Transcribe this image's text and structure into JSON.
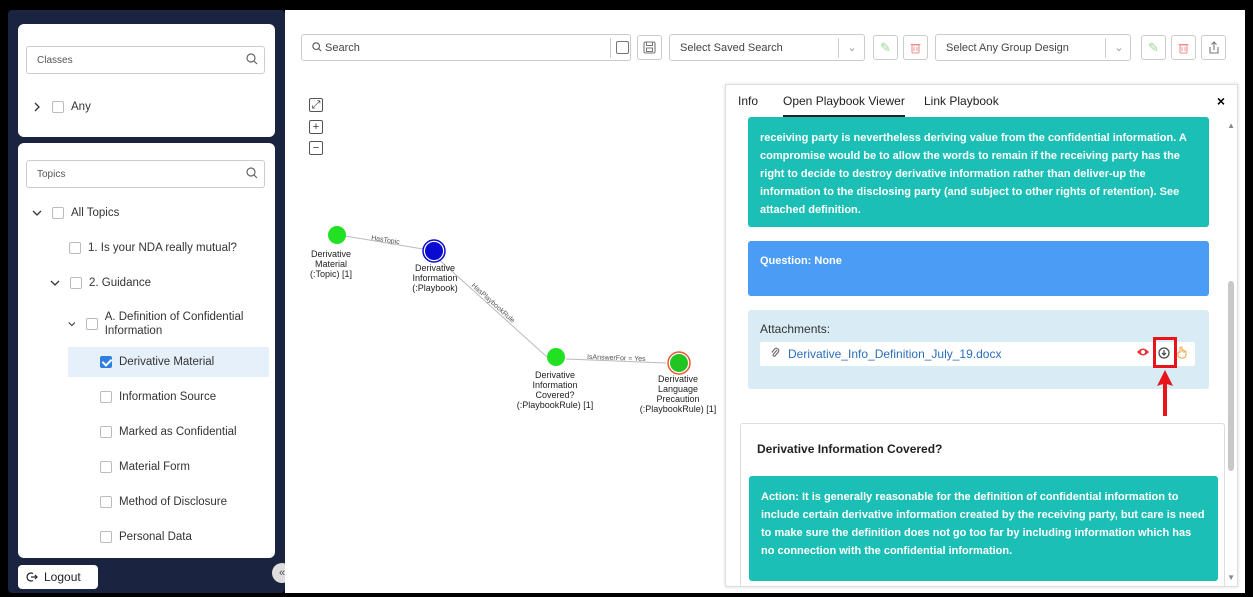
{
  "sidebar": {
    "classes_placeholder": "Classes",
    "classes_tree": [
      {
        "label": "Any"
      }
    ],
    "topics_placeholder": "Topics",
    "topics_tree": [
      {
        "label": "All Topics"
      },
      {
        "label": "1. Is your NDA really mutual?"
      },
      {
        "label": "2. Guidance"
      },
      {
        "label": "A. Definition of Confidential Information"
      },
      {
        "label": "Derivative Material",
        "checked": true
      },
      {
        "label": "Information Source"
      },
      {
        "label": "Marked as Confidential"
      },
      {
        "label": "Material Form"
      },
      {
        "label": "Method of Disclosure"
      },
      {
        "label": "Personal Data"
      }
    ],
    "logout_label": "Logout",
    "collapse_icon": "«"
  },
  "toolbar": {
    "search_placeholder": "Search",
    "saved_search_placeholder": "Select Saved Search",
    "group_design_placeholder": "Select Any Group Design"
  },
  "graph": {
    "nodes": [
      {
        "id": "n1",
        "label": "Derivative Material (:Topic) [1]",
        "color": "#22e022"
      },
      {
        "id": "n2",
        "label": "Derivative Information (:Playbook)",
        "color": "#0a0ad0"
      },
      {
        "id": "n3",
        "label": "Derivative Information Covered? (:PlaybookRule) [1]",
        "color": "#22e022"
      },
      {
        "id": "n4",
        "label": "Derivative Language Precaution (:PlaybookRule) [1]",
        "color": "#22c422"
      }
    ],
    "edges": [
      {
        "label": "HasTopic"
      },
      {
        "label": "HasPlaybookRule"
      },
      {
        "label": "IsAnswerFor = Yes"
      }
    ]
  },
  "panel": {
    "tabs": [
      {
        "label": "Info"
      },
      {
        "label": "Open Playbook Viewer",
        "active": true
      },
      {
        "label": "Link Playbook"
      }
    ],
    "close_icon": "×",
    "action_text_top": "receiving party is nevertheless deriving value from the confidential information. A compromise would be to allow the words to remain if the receiving party has the right to decide to destroy derivative information rather than deliver-up the information to the disclosing party (and subject to other rights of retention). See attached definition.",
    "question_text": "Question: None",
    "attachments_title": "Attachments:",
    "attachment_file": "Derivative_Info_Definition_July_19.docx",
    "rule_title": "Derivative Information Covered?",
    "action_text_bottom": "Action: It is generally reasonable for the definition of confidential information to include certain derivative information created by the receiving party, but care is need to make sure the definition does not go too far by including information which has no connection with the confidential information."
  },
  "colors": {
    "sidebar_bg": "#1a2340",
    "teal": "#1cbfb5",
    "blue": "#4b9cf4",
    "highlight": "#e8141c"
  }
}
